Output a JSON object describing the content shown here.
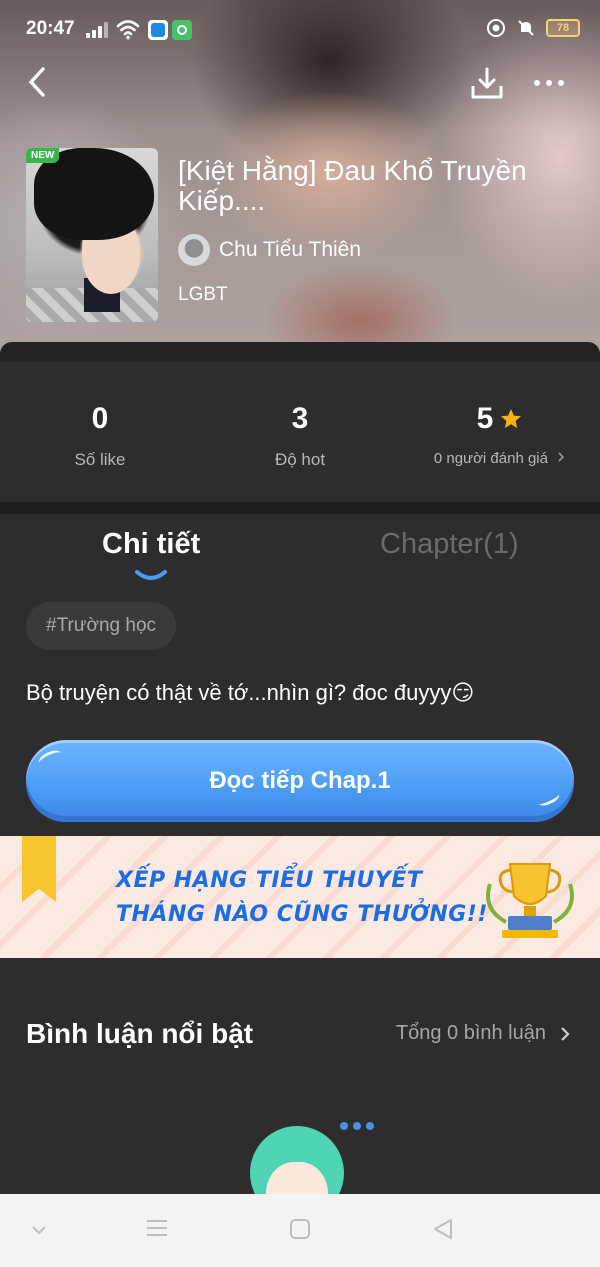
{
  "status_bar": {
    "time": "20:47",
    "battery": "78"
  },
  "header": {
    "badge": "NEW",
    "title": "[Kiệt Hằng] Đau Khổ Truyền Kiếp....",
    "author": "Chu Tiểu Thiên",
    "genre": "LGBT"
  },
  "stats": {
    "likes": {
      "value": "0",
      "label": "Số like"
    },
    "hot": {
      "value": "3",
      "label": "Độ hot"
    },
    "rating": {
      "value": "5",
      "label": "0 người đánh giá"
    }
  },
  "tabs": {
    "details": "Chi tiết",
    "chapters": "Chapter(1)"
  },
  "detail": {
    "tag": "#Trường học",
    "description": "Bộ truyện có thật về tớ...nhìn gì? đoc đuyyy😏",
    "read_button": "Đọc tiếp Chap.1"
  },
  "banner": {
    "line1": "XẾP HẠNG TIỂU THUYẾT",
    "line2": "THÁNG NÀO CŨNG THƯỞNG!!"
  },
  "comments": {
    "title": "Bình luận nổi bật",
    "total": "Tổng 0 bình luận"
  },
  "colors": {
    "accent": "#4b9cf5",
    "star": "#f7b500",
    "background": "#2d2d2d"
  }
}
